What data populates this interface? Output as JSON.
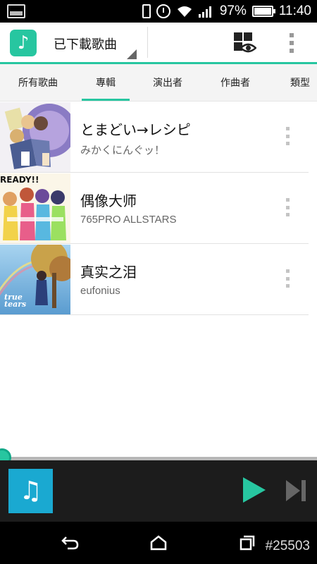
{
  "status_bar": {
    "battery": "97%",
    "time": "11:40",
    "icons": [
      "screenshot-icon",
      "vibrate-icon",
      "alarm-icon",
      "wifi-icon",
      "signal-icon",
      "battery-icon"
    ]
  },
  "app_bar": {
    "title": "已下載歌曲",
    "logo_icon": "music-note-icon",
    "actions": [
      "view-mode-icon",
      "overflow-menu-icon"
    ]
  },
  "tabs": [
    {
      "label": "所有歌曲",
      "active": false
    },
    {
      "label": "專輯",
      "active": true
    },
    {
      "label": "演出者",
      "active": false
    },
    {
      "label": "作曲者",
      "active": false
    },
    {
      "label": "類型",
      "active": false
    }
  ],
  "albums": [
    {
      "title": "とまどい→レシピ",
      "artist": "みかくにんぐッ！"
    },
    {
      "title": "偶像大师",
      "artist": "765PRO ALLSTARS",
      "art_text": "READY!!"
    },
    {
      "title": "真实之泪",
      "artist": "eufonius",
      "art_text": "true tears"
    }
  ],
  "player": {
    "art_icon": "music-note-icon",
    "progress": 0.0
  },
  "nav_bar": {
    "buttons": [
      "back-icon",
      "home-icon",
      "recent-apps-icon"
    ],
    "watermark": "#25503"
  },
  "colors": {
    "accent": "#27c6a0",
    "player_art": "#1aa9d1",
    "player_bg": "#1c1c1c"
  }
}
